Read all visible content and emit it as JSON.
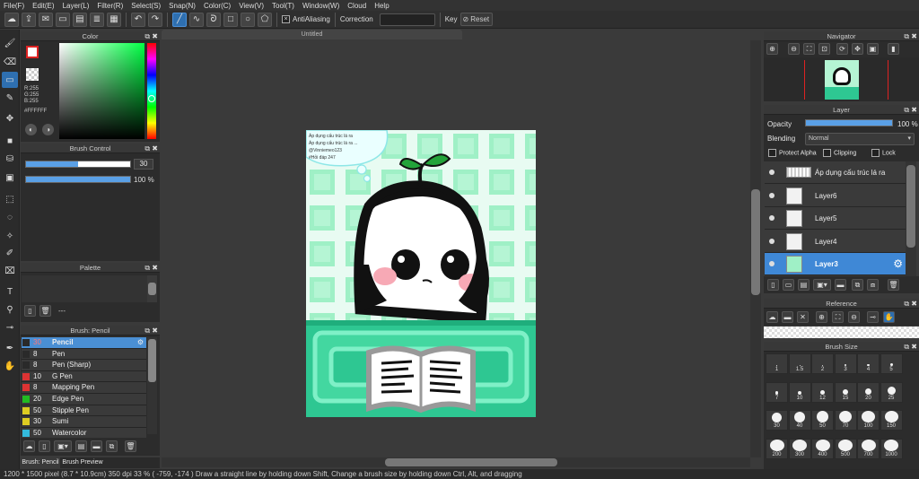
{
  "menu": [
    "File(F)",
    "Edit(E)",
    "Layer(L)",
    "Filter(R)",
    "Select(S)",
    "Snap(N)",
    "Color(C)",
    "View(V)",
    "Tool(T)",
    "Window(W)",
    "Cloud",
    "Help"
  ],
  "toolbar": {
    "antialiasing": "AntiAliasing",
    "correction": "Correction",
    "key": "Key",
    "reset": "Reset"
  },
  "document": {
    "title": "Untitled"
  },
  "color_panel": {
    "title": "Color",
    "r": "R:255",
    "g": "G:255",
    "b": "B:255",
    "hex": "#FFFFFF"
  },
  "brush_control": {
    "title": "Brush Control",
    "size": "30",
    "opacity": "100 %",
    "opacity_value": 1.0,
    "size_fill": 0.5
  },
  "palette": {
    "title": "Palette",
    "dash": "---"
  },
  "brush_list": {
    "title": "Brush: Pencil",
    "items": [
      {
        "size": "30",
        "name": "Pencil",
        "color": "#2a2a2a"
      },
      {
        "size": "8",
        "name": "Pen",
        "color": "#2a2a2a"
      },
      {
        "size": "8",
        "name": "Pen (Sharp)",
        "color": "#2a2a2a"
      },
      {
        "size": "10",
        "name": "G Pen",
        "color": "#d33"
      },
      {
        "size": "8",
        "name": "Mapping Pen",
        "color": "#d33"
      },
      {
        "size": "20",
        "name": "Edge Pen",
        "color": "#2b2"
      },
      {
        "size": "50",
        "name": "Stipple Pen",
        "color": "#dc2"
      },
      {
        "size": "30",
        "name": "Sumi",
        "color": "#dc2"
      },
      {
        "size": "50",
        "name": "Watercolor",
        "color": "#3bd"
      }
    ],
    "tabs": [
      "Brush: Pencil",
      "Brush Preview"
    ]
  },
  "navigator": {
    "title": "Navigator"
  },
  "layer_panel": {
    "title": "Layer",
    "opacity_label": "Opacity",
    "opacity": "100 %",
    "opacity_value": 1.0,
    "blending_label": "Blending",
    "blending": "Normal",
    "protect_alpha": "Protect Alpha",
    "clipping": "Clipping",
    "lock": "Lock",
    "layers": [
      "Áp dụng cấu trúc lá ra",
      "Layer6",
      "Layer5",
      "Layer4",
      "Layer3"
    ]
  },
  "reference": {
    "title": "Reference"
  },
  "brush_size": {
    "title": "Brush Size",
    "sizes": [
      "1",
      "1.5",
      "2",
      "3",
      "4",
      "5",
      "7",
      "10",
      "12",
      "15",
      "20",
      "25",
      "30",
      "40",
      "50",
      "70",
      "100",
      "150",
      "200",
      "300",
      "400",
      "500",
      "700",
      "1000"
    ]
  },
  "canvas_text": [
    "Áp dụng cấu trúc lá ra",
    "Áp dụng cấu trúc lá ra ...",
    "@Vinniemeo123",
    "#Hỏi đáp 247"
  ],
  "status": "1200 * 1500 pixel   (8.7 * 10.9cm)   350 dpi   33 %   ( -759, -174 )   Draw a straight line by holding down Shift, Change a brush size by holding down Ctrl, Alt, and dragging"
}
